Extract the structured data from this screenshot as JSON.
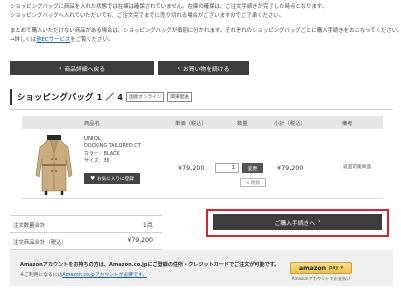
{
  "notice": {
    "line1": "ショッピングバッグに商品を入れた状態では在庫は確保されていません。在庫の確保は、ご注文手続きが完了した時点となります。",
    "line2": "ショッピングバッグへ入れていただいても、ご注文完了までに売り切れる場合がございますのでご了承ください。",
    "line3": "まとめて購入いただけない商品がある場合は、ショッピングバッグが個別に分かれます。それぞれのショッピングバッグごとに購入手続きをおこなってください。",
    "line4_prefix": "→詳しくは",
    "line4_link": "他ECサービス",
    "line4_suffix": "をご覧ください。"
  },
  "nav": {
    "back_label": "商品詳細へ戻る",
    "continue_label": "お買い物を続ける"
  },
  "bag": {
    "title": "ショッピングバッグ 1 ／ 4",
    "tags": [
      "国産オンライン",
      "関東配送"
    ]
  },
  "table": {
    "headers": [
      "商品名",
      "単価（税込）",
      "数量",
      "小計（税込）",
      "備考"
    ]
  },
  "item": {
    "brand": "UNIQL",
    "name": "DOCKING TAILORED CT",
    "color": "カラー：BLACK",
    "size": "サイズ：36",
    "fav_label": "お気に入りに登録",
    "unit_price": "¥79,200",
    "quantity": "1",
    "change_label": "変更",
    "delete_label": "× 削除",
    "subtotal": "¥79,200",
    "note": "返品可能商品"
  },
  "summary": {
    "count_label": "注文数量合計",
    "count_value": "1点",
    "amount_label": "注文商品合計（税込）",
    "amount_value": "¥79,200"
  },
  "checkout": {
    "label": "ご購入手続きへ"
  },
  "amazon": {
    "line1": "Amazonアカウントをお持ちの方は、Amazon.co.jpにご登録の住所・クレジットカードでご注文が可能です。",
    "line2_prefix": "※ご利用になるには",
    "line2_link": "Amazon.co.jpアカウントが必要です。",
    "button_brand": "amazon",
    "button_pay": "pay",
    "caption": "Amazonアカウントでお支払い"
  },
  "colors": {
    "button_dark": "#3d3d3d",
    "highlight_red": "#d9232d",
    "link_blue": "#1a5fb4"
  }
}
